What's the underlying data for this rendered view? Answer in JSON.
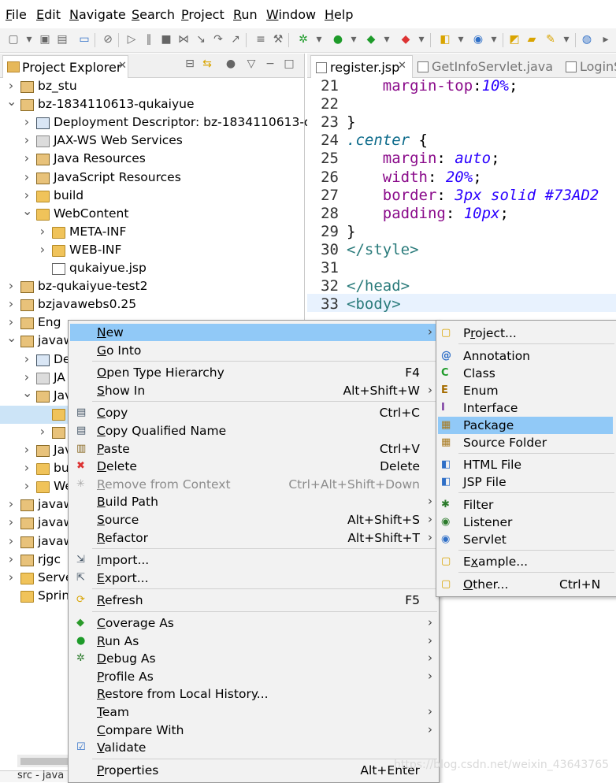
{
  "menubar": [
    "File",
    "Edit",
    "Navigate",
    "Search",
    "Project",
    "Run",
    "Window",
    "Help"
  ],
  "explorer": {
    "tab_label": "Project Explorer",
    "tree": [
      {
        "label": "bz_stu",
        "twisty": ">"
      },
      {
        "label": "bz-1834110613-qukaiyue",
        "twisty": "v"
      },
      {
        "label": "Deployment Descriptor: bz-1834110613-qu",
        "twisty": ">"
      },
      {
        "label": "JAX-WS Web Services",
        "twisty": ">"
      },
      {
        "label": "Java Resources",
        "twisty": ">"
      },
      {
        "label": "JavaScript Resources",
        "twisty": ">"
      },
      {
        "label": "build",
        "twisty": ">"
      },
      {
        "label": "WebContent",
        "twisty": "v"
      },
      {
        "label": "META-INF",
        "twisty": ">"
      },
      {
        "label": "WEB-INF",
        "twisty": ">"
      },
      {
        "label": "qukaiyue.jsp",
        "twisty": ""
      },
      {
        "label": "bz-qukaiyue-test2",
        "twisty": ">"
      },
      {
        "label": "bzjavawebs0.25",
        "twisty": ">"
      },
      {
        "label": "Eng",
        "twisty": ">"
      },
      {
        "label": "javaw",
        "twisty": "v"
      },
      {
        "label": "De",
        "twisty": ">"
      },
      {
        "label": "JA",
        "twisty": ">"
      },
      {
        "label": "Jav",
        "twisty": "v"
      },
      {
        "label": "",
        "twisty": ""
      },
      {
        "label": "",
        "twisty": ">"
      },
      {
        "label": "Jav",
        "twisty": ">"
      },
      {
        "label": "bu",
        "twisty": ">"
      },
      {
        "label": "We",
        "twisty": ">"
      },
      {
        "label": "javaw",
        "twisty": ">"
      },
      {
        "label": "javaw",
        "twisty": ">"
      },
      {
        "label": "javaw",
        "twisty": ">"
      },
      {
        "label": "rjgc",
        "twisty": ">"
      },
      {
        "label": "Serve",
        "twisty": ">"
      },
      {
        "label": "Sprin",
        "twisty": ""
      }
    ],
    "bottom_text": "src - java"
  },
  "editor": {
    "tabs": [
      "register.jsp",
      "GetInfoServlet.java",
      "LoginS"
    ],
    "lines": [
      {
        "n": "21",
        "parts": [
          [
            "",
            "    "
          ],
          [
            "prop",
            "margin-top"
          ],
          [
            "",
            ":"
          ],
          [
            "val",
            "10%"
          ],
          [
            "",
            ";"
          ]
        ]
      },
      {
        "n": "22",
        "parts": []
      },
      {
        "n": "23",
        "parts": [
          [
            "",
            "}"
          ]
        ]
      },
      {
        "n": "24",
        "parts": [
          [
            "sele",
            ".center"
          ],
          [
            "",
            " {"
          ]
        ]
      },
      {
        "n": "25",
        "parts": [
          [
            "",
            "    "
          ],
          [
            "prop",
            "margin"
          ],
          [
            "",
            ": "
          ],
          [
            "val",
            "auto"
          ],
          [
            "",
            ";"
          ]
        ]
      },
      {
        "n": "26",
        "parts": [
          [
            "",
            "    "
          ],
          [
            "prop",
            "width"
          ],
          [
            "",
            ": "
          ],
          [
            "val",
            "20%"
          ],
          [
            "",
            ";"
          ]
        ]
      },
      {
        "n": "27",
        "parts": [
          [
            "",
            "    "
          ],
          [
            "prop",
            "border"
          ],
          [
            "",
            ": "
          ],
          [
            "val",
            "3px solid #73AD2"
          ]
        ]
      },
      {
        "n": "28",
        "parts": [
          [
            "",
            "    "
          ],
          [
            "prop",
            "padding"
          ],
          [
            "",
            ": "
          ],
          [
            "val",
            "10px"
          ],
          [
            "",
            ";"
          ]
        ]
      },
      {
        "n": "29",
        "parts": [
          [
            "",
            "}"
          ]
        ]
      },
      {
        "n": "30",
        "parts": [
          [
            "tag",
            "</style>"
          ]
        ]
      },
      {
        "n": "31",
        "parts": []
      },
      {
        "n": "32",
        "parts": [
          [
            "tag",
            "</head>"
          ]
        ]
      },
      {
        "n": "33",
        "parts": [
          [
            "tag",
            "<body>"
          ]
        ]
      }
    ]
  },
  "context_menu": [
    {
      "label": "New",
      "shortcut": "",
      "arrow": true,
      "hl": true,
      "icon": ""
    },
    {
      "label": "Go Into",
      "shortcut": "",
      "icon": ""
    },
    {
      "sep": true
    },
    {
      "label": "Open Type Hierarchy",
      "shortcut": "F4",
      "icon": ""
    },
    {
      "label": "Show In",
      "shortcut": "Alt+Shift+W",
      "arrow": true,
      "icon": ""
    },
    {
      "sep": true
    },
    {
      "label": "Copy",
      "shortcut": "Ctrl+C",
      "icon": "copy"
    },
    {
      "label": "Copy Qualified Name",
      "shortcut": "",
      "icon": "copy"
    },
    {
      "label": "Paste",
      "shortcut": "Ctrl+V",
      "icon": "paste"
    },
    {
      "label": "Delete",
      "shortcut": "Delete",
      "icon": "delete"
    },
    {
      "label": "Remove from Context",
      "shortcut": "Ctrl+Alt+Shift+Down",
      "disabled": true,
      "icon": "remove"
    },
    {
      "label": "Build Path",
      "shortcut": "",
      "arrow": true,
      "icon": ""
    },
    {
      "label": "Source",
      "shortcut": "Alt+Shift+S",
      "arrow": true,
      "icon": ""
    },
    {
      "label": "Refactor",
      "shortcut": "Alt+Shift+T",
      "arrow": true,
      "icon": ""
    },
    {
      "sep": true
    },
    {
      "label": "Import...",
      "shortcut": "",
      "icon": "import"
    },
    {
      "label": "Export...",
      "shortcut": "",
      "icon": "export"
    },
    {
      "sep": true
    },
    {
      "label": "Refresh",
      "shortcut": "F5",
      "icon": "refresh"
    },
    {
      "sep": true
    },
    {
      "label": "Coverage As",
      "shortcut": "",
      "arrow": true,
      "icon": "coverage"
    },
    {
      "label": "Run As",
      "shortcut": "",
      "arrow": true,
      "icon": "run"
    },
    {
      "label": "Debug As",
      "shortcut": "",
      "arrow": true,
      "icon": "debug"
    },
    {
      "label": "Profile As",
      "shortcut": "",
      "arrow": true,
      "icon": ""
    },
    {
      "label": "Restore from Local History...",
      "shortcut": "",
      "icon": ""
    },
    {
      "label": "Team",
      "shortcut": "",
      "arrow": true,
      "icon": ""
    },
    {
      "label": "Compare With",
      "shortcut": "",
      "arrow": true,
      "icon": ""
    },
    {
      "label": "Validate",
      "shortcut": "",
      "icon": "check"
    },
    {
      "sep": true
    },
    {
      "label": "Properties",
      "shortcut": "Alt+Enter",
      "icon": ""
    }
  ],
  "new_submenu": [
    {
      "label": "Project...",
      "icon": "project"
    },
    {
      "sep": true
    },
    {
      "label": "Annotation",
      "icon": "annotation"
    },
    {
      "label": "Class",
      "icon": "class"
    },
    {
      "label": "Enum",
      "icon": "enum"
    },
    {
      "label": "Interface",
      "icon": "interface"
    },
    {
      "label": "Package",
      "icon": "package",
      "hl": true
    },
    {
      "label": "Source Folder",
      "icon": "srcfolder"
    },
    {
      "sep": true
    },
    {
      "label": "HTML File",
      "icon": "html"
    },
    {
      "label": "JSP File",
      "icon": "jsp"
    },
    {
      "sep": true
    },
    {
      "label": "Filter",
      "icon": "filter"
    },
    {
      "label": "Listener",
      "icon": "listener"
    },
    {
      "label": "Servlet",
      "icon": "servlet"
    },
    {
      "sep": true
    },
    {
      "label": "Example...",
      "icon": "example"
    },
    {
      "sep": true
    },
    {
      "label": "Other...",
      "shortcut": "Ctrl+N",
      "icon": "other"
    }
  ],
  "watermark": "https://blog.csdn.net/weixin_43643765",
  "colors": {
    "highlight": "#91c9f7",
    "menu_bg": "#f2f2f2",
    "prop": "#8a0a8a",
    "value": "#2a00ff",
    "tag": "#2a7b7b"
  }
}
